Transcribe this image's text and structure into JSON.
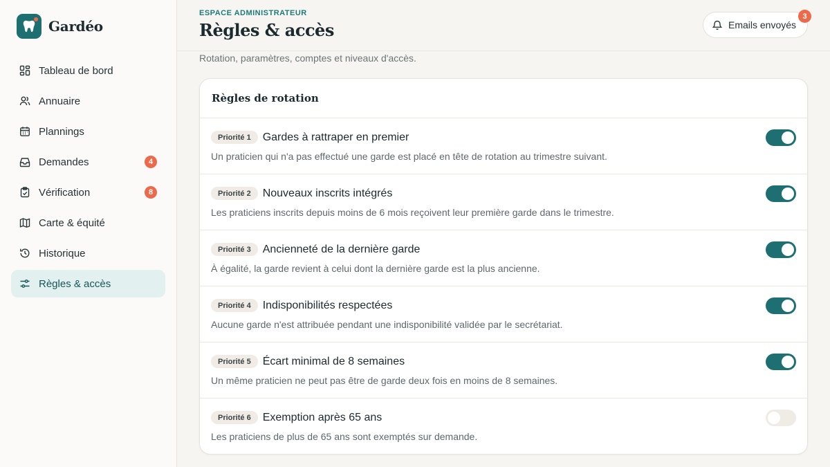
{
  "brand": {
    "name": "Gardéo"
  },
  "sidebar": {
    "items": [
      {
        "label": "Tableau de bord",
        "icon": "dashboard-icon"
      },
      {
        "label": "Annuaire",
        "icon": "users-icon"
      },
      {
        "label": "Plannings",
        "icon": "calendar-icon"
      },
      {
        "label": "Demandes",
        "icon": "inbox-icon",
        "badge": "4"
      },
      {
        "label": "Vérification",
        "icon": "clipboard-check-icon",
        "badge": "8"
      },
      {
        "label": "Carte & équité",
        "icon": "map-icon"
      },
      {
        "label": "Historique",
        "icon": "history-icon"
      },
      {
        "label": "Règles & accès",
        "icon": "sliders-icon",
        "active": true
      }
    ]
  },
  "header": {
    "eyebrow": "ESPACE ADMINISTRATEUR",
    "title": "Règles & accès",
    "emails_label": "Emails envoyés",
    "emails_badge": "3"
  },
  "subtitle": "Rotation, paramètres, comptes et niveaux d'accès.",
  "rules_card": {
    "title": "Règles de rotation",
    "rules": [
      {
        "priority": "Priorité 1",
        "title": "Gardes à rattraper en premier",
        "description": "Un praticien qui n'a pas effectué une garde est placé en tête de rotation au trimestre suivant.",
        "enabled": true
      },
      {
        "priority": "Priorité 2",
        "title": "Nouveaux inscrits intégrés",
        "description": "Les praticiens inscrits depuis moins de 6 mois reçoivent leur première garde dans le trimestre.",
        "enabled": true
      },
      {
        "priority": "Priorité 3",
        "title": "Ancienneté de la dernière garde",
        "description": "À égalité, la garde revient à celui dont la dernière garde est la plus ancienne.",
        "enabled": true
      },
      {
        "priority": "Priorité 4",
        "title": "Indisponibilités respectées",
        "description": "Aucune garde n'est attribuée pendant une indisponibilité validée par le secrétariat.",
        "enabled": true
      },
      {
        "priority": "Priorité 5",
        "title": "Écart minimal de 8 semaines",
        "description": "Un même praticien ne peut pas être de garde deux fois en moins de 8 semaines.",
        "enabled": true
      },
      {
        "priority": "Priorité 6",
        "title": "Exemption après 65 ans",
        "description": "Les praticiens de plus de 65 ans sont exemptés sur demande.",
        "enabled": false
      }
    ]
  },
  "colors": {
    "accent": "#1d6f72",
    "badge": "#ec6a4a",
    "active_bg": "#e2f1ef"
  }
}
